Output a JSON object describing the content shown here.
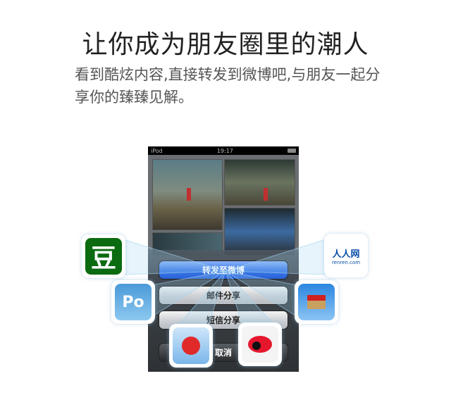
{
  "headline": "让你成为朋友圈里的潮人",
  "subtitle": "看到酷炫内容,直接转发到微博吧,与朋友一起分享你的臻臻见解。",
  "phone": {
    "status": {
      "carrier": "iPod",
      "time": "19:17"
    },
    "actions": [
      {
        "label": "转发至微博"
      },
      {
        "label": "邮件分享"
      },
      {
        "label": "短信分享"
      },
      {
        "label": "取消"
      }
    ]
  },
  "share_icons": [
    {
      "name": "douban-icon",
      "glyph": "豆",
      "color": "#0a6b10"
    },
    {
      "name": "renren-icon",
      "text": "人人网",
      "sub": "renren.com",
      "color": "#0b4fa8"
    },
    {
      "name": "pengyou-icon",
      "glyph": "Po",
      "color": "#5aa8e0"
    },
    {
      "name": "kaixin-icon",
      "color": "#2a86e0"
    },
    {
      "name": "tencent-weibo-icon",
      "color": "#e02a2a"
    },
    {
      "name": "sina-weibo-icon",
      "color": "#e6162d"
    }
  ]
}
